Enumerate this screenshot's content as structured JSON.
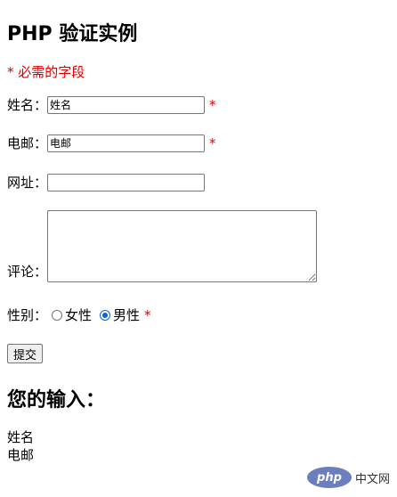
{
  "title": "PHP 验证实例",
  "required_note": "* 必需的字段",
  "form": {
    "name": {
      "label": "姓名：",
      "value": "姓名",
      "required_mark": "*"
    },
    "email": {
      "label": "电邮：",
      "value": "电邮",
      "required_mark": "*"
    },
    "website": {
      "label": "网址：",
      "value": ""
    },
    "comment": {
      "label": "评论：",
      "value": ""
    },
    "gender": {
      "label": "性别：",
      "options": [
        {
          "label": "女性",
          "checked": false
        },
        {
          "label": "男性",
          "checked": true
        }
      ],
      "required_mark": "*"
    },
    "submit_label": "提交"
  },
  "output": {
    "heading": "您的输入：",
    "lines": [
      "姓名",
      "电邮"
    ]
  },
  "watermark": {
    "logo": "php",
    "text": "中文网"
  },
  "colors": {
    "required": "#e00000",
    "radio_accent": "#0a64d4"
  }
}
